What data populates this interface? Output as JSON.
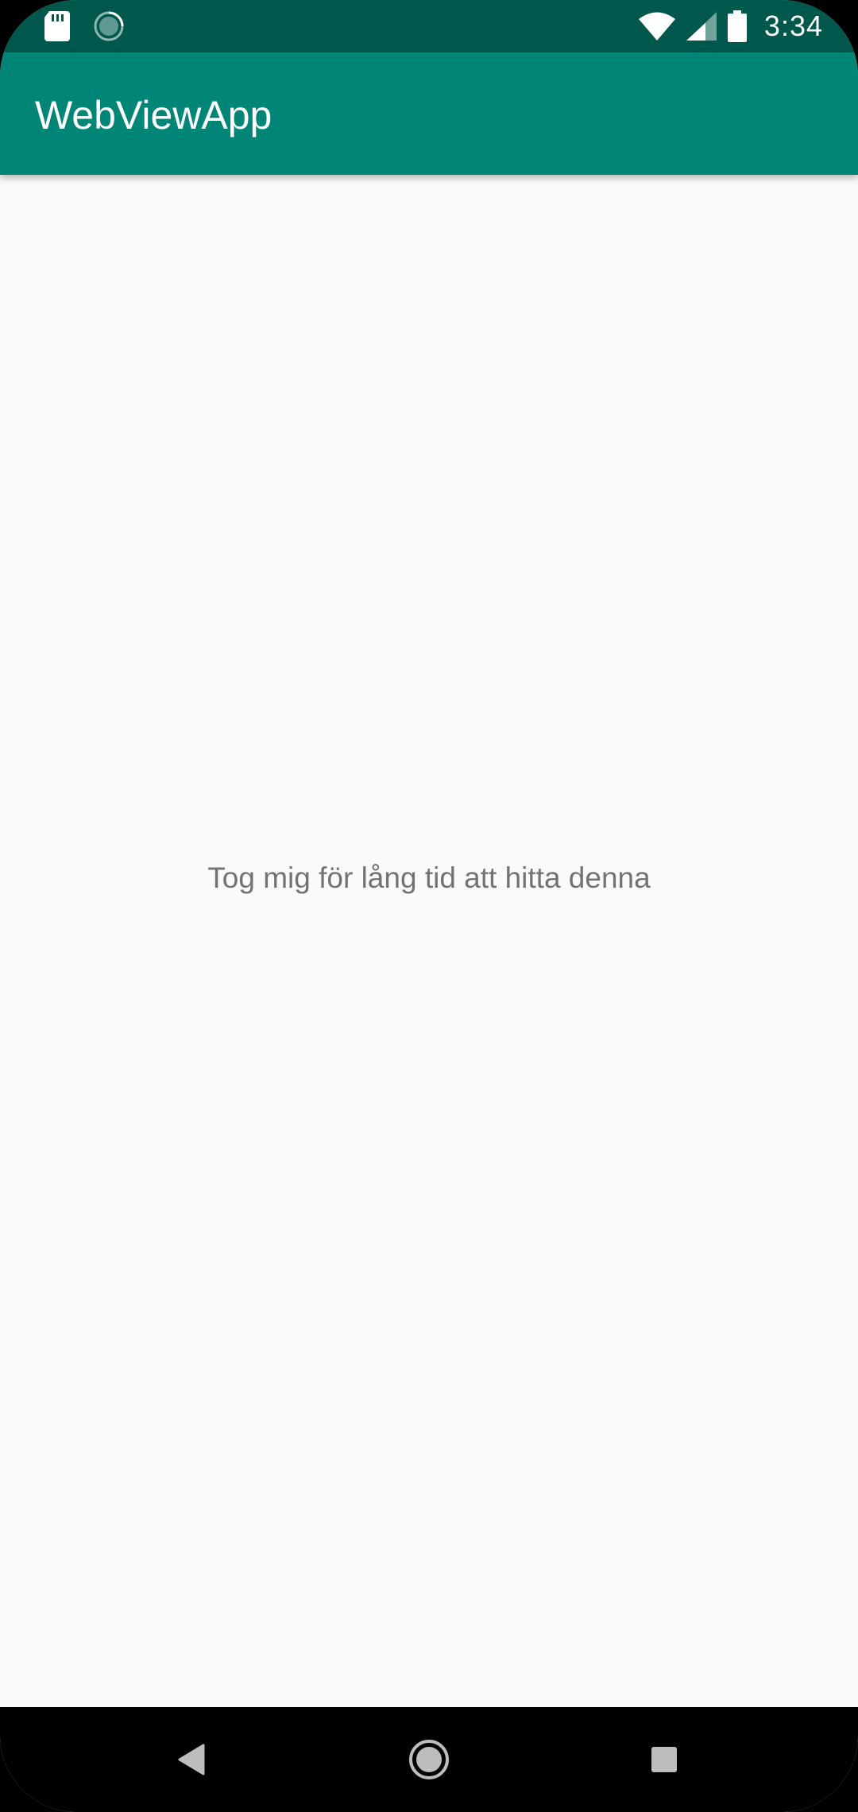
{
  "status_bar": {
    "time": "3:34",
    "icons": [
      "sd-card-icon",
      "loading-spinner-icon",
      "wifi-icon",
      "signal-icon",
      "battery-icon"
    ],
    "color": "#00574b"
  },
  "app_bar": {
    "title": "WebViewApp",
    "color": "#008577"
  },
  "content": {
    "message": "Tog mig för lång tid att hitta denna",
    "background": "#fafafa",
    "text_color": "#737373"
  },
  "nav_bar": {
    "buttons": [
      "back-icon",
      "home-icon",
      "recents-icon"
    ],
    "color": "#000000"
  }
}
